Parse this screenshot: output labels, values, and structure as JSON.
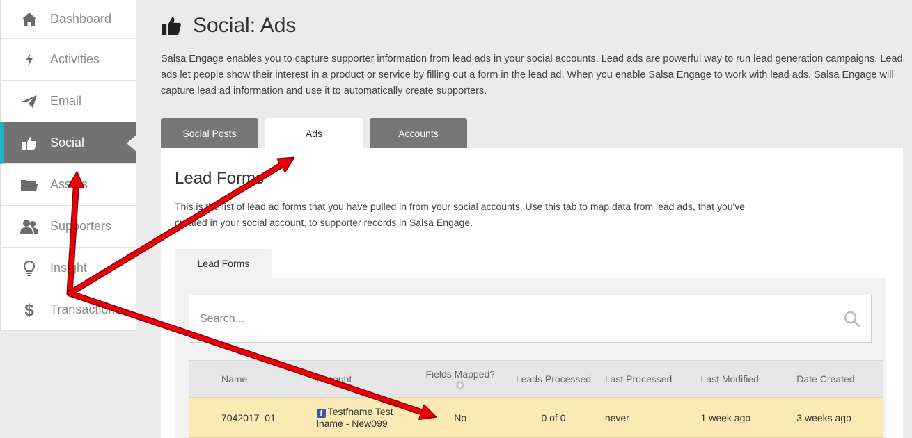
{
  "sidebar": {
    "items": [
      {
        "label": "Dashboard",
        "icon": "home-icon"
      },
      {
        "label": "Activities",
        "icon": "lightning-icon"
      },
      {
        "label": "Email",
        "icon": "paper-plane-icon"
      },
      {
        "label": "Social",
        "icon": "thumbs-up-icon",
        "active": true
      },
      {
        "label": "Assets",
        "icon": "folder-icon"
      },
      {
        "label": "Supporters",
        "icon": "users-icon"
      },
      {
        "label": "Insight",
        "icon": "lightbulb-icon"
      },
      {
        "label": "Transactions",
        "icon": "dollar-icon"
      }
    ]
  },
  "page": {
    "title": "Social: Ads",
    "intro": "Salsa Engage enables you to capture supporter information from lead ads in your social accounts. Lead ads are powerful way to run lead generation campaigns. Lead ads let people show their interest in a product or service by filling out a form in the lead ad. When you enable Salsa Engage to work with lead ads, Salsa Engage will capture lead ad information and use it to automatically create supporters."
  },
  "tabs": [
    {
      "label": "Social Posts"
    },
    {
      "label": "Ads",
      "active": true
    },
    {
      "label": "Accounts"
    }
  ],
  "panel": {
    "title": "Lead Forms",
    "description": "This is the list of lead ad forms that you have pulled in from your social accounts. Use this tab to map data from lead ads, that you've created in your social account, to supporter records in Salsa Engage.",
    "subtab": "Lead Forms",
    "search_placeholder": "Search..."
  },
  "table": {
    "headers": [
      "Name",
      "Account",
      "Fields Mapped?",
      "Leads Processed",
      "Last Processed",
      "Last Modified",
      "Date Created"
    ],
    "rows": [
      {
        "name": "7042017_01",
        "account": "Testfname Test lname - New099",
        "fields_mapped": "No",
        "leads_processed": "0 of 0",
        "last_processed": "never",
        "last_modified": "1 week ago",
        "date_created": "3 weeks ago"
      }
    ]
  },
  "colors": {
    "accent": "#1fb3c2",
    "active_nav": "#727272",
    "tab_inactive": "#777777",
    "row_highlight": "#fbe9b6",
    "annotation_arrow": "#e8000b"
  }
}
